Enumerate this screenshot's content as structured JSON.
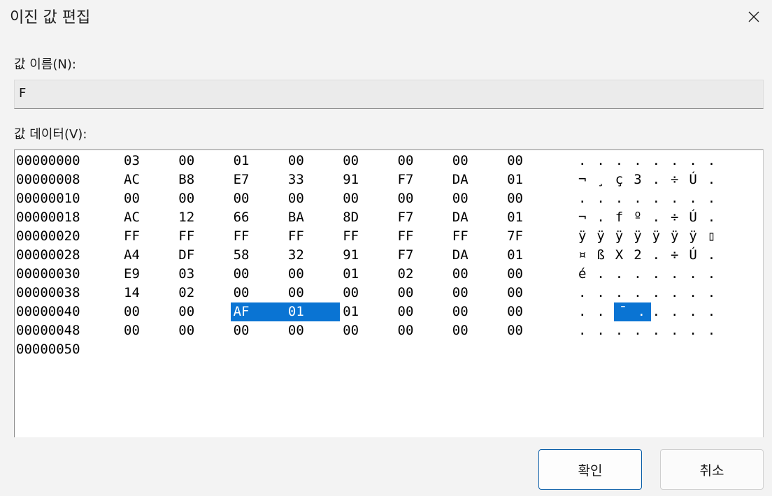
{
  "window": {
    "title": "이진 값 편집",
    "close_icon": "close-icon"
  },
  "value_name": {
    "label": "값 이름(N):",
    "value": "F"
  },
  "value_data": {
    "label": "값 데이터(V):",
    "rows": [
      {
        "offset": "00000000",
        "bytes": [
          "03",
          "00",
          "01",
          "00",
          "00",
          "00",
          "00",
          "00"
        ],
        "chars": [
          ".",
          ".",
          ".",
          ".",
          ".",
          ".",
          ".",
          "."
        ]
      },
      {
        "offset": "00000008",
        "bytes": [
          "AC",
          "B8",
          "E7",
          "33",
          "91",
          "F7",
          "DA",
          "01"
        ],
        "chars": [
          "¬",
          "¸",
          "ç",
          "3",
          ".",
          "÷",
          "Ú",
          "."
        ]
      },
      {
        "offset": "00000010",
        "bytes": [
          "00",
          "00",
          "00",
          "00",
          "00",
          "00",
          "00",
          "00"
        ],
        "chars": [
          ".",
          ".",
          ".",
          ".",
          ".",
          ".",
          ".",
          "."
        ]
      },
      {
        "offset": "00000018",
        "bytes": [
          "AC",
          "12",
          "66",
          "BA",
          "8D",
          "F7",
          "DA",
          "01"
        ],
        "chars": [
          "¬",
          ".",
          "f",
          "º",
          ".",
          "÷",
          "Ú",
          "."
        ]
      },
      {
        "offset": "00000020",
        "bytes": [
          "FF",
          "FF",
          "FF",
          "FF",
          "FF",
          "FF",
          "FF",
          "7F"
        ],
        "chars": [
          "ÿ",
          "ÿ",
          "ÿ",
          "ÿ",
          "ÿ",
          "ÿ",
          "ÿ",
          "▯"
        ]
      },
      {
        "offset": "00000028",
        "bytes": [
          "A4",
          "DF",
          "58",
          "32",
          "91",
          "F7",
          "DA",
          "01"
        ],
        "chars": [
          "¤",
          "ß",
          "X",
          "2",
          ".",
          "÷",
          "Ú",
          "."
        ]
      },
      {
        "offset": "00000030",
        "bytes": [
          "E9",
          "03",
          "00",
          "00",
          "01",
          "02",
          "00",
          "00"
        ],
        "chars": [
          "é",
          ".",
          ".",
          ".",
          ".",
          ".",
          ".",
          "."
        ]
      },
      {
        "offset": "00000038",
        "bytes": [
          "14",
          "02",
          "00",
          "00",
          "00",
          "00",
          "00",
          "00"
        ],
        "chars": [
          ".",
          ".",
          ".",
          ".",
          ".",
          ".",
          ".",
          "."
        ]
      },
      {
        "offset": "00000040",
        "bytes": [
          "00",
          "00",
          "AF",
          "01",
          "01",
          "00",
          "00",
          "00"
        ],
        "chars": [
          ".",
          ".",
          "¯",
          ".",
          ".",
          ".",
          ".",
          "."
        ]
      },
      {
        "offset": "00000048",
        "bytes": [
          "00",
          "00",
          "00",
          "00",
          "00",
          "00",
          "00",
          "00"
        ],
        "chars": [
          ".",
          ".",
          ".",
          ".",
          ".",
          ".",
          ".",
          "."
        ]
      },
      {
        "offset": "00000050",
        "bytes": [],
        "chars": []
      }
    ],
    "selected_row": 8,
    "selected_bytes": [
      2,
      3
    ]
  },
  "buttons": {
    "ok": "확인",
    "cancel": "취소"
  }
}
